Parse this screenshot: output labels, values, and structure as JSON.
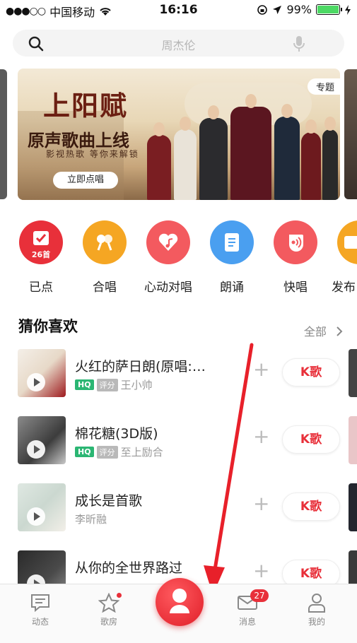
{
  "status_bar": {
    "carrier": "中国移动",
    "time": "16:16",
    "battery": "99%"
  },
  "search": {
    "placeholder": "周杰伦"
  },
  "banner": {
    "title": "上阳赋",
    "subtitle": "原声歌曲上线",
    "tagline": "影视热歌 等你来解锁",
    "button": "立即点唱",
    "tag": "专题"
  },
  "quick_actions": [
    {
      "label": "已点",
      "badge": "26首",
      "color": "#e8303a"
    },
    {
      "label": "合唱",
      "color": "#f5a623"
    },
    {
      "label": "心动对唱",
      "color": "#f35a5f"
    },
    {
      "label": "朗诵",
      "color": "#4a9ff0"
    },
    {
      "label": "快唱",
      "color": "#f35a5f"
    },
    {
      "label": "发布",
      "color": "#f5a623"
    }
  ],
  "section": {
    "title": "猜你喜欢",
    "all_label": "全部"
  },
  "songs": [
    {
      "title": "火红的萨日朗(原唱:…",
      "hq": "HQ",
      "score": "评分",
      "artist": "王小帅",
      "k_label": "K歌"
    },
    {
      "title": "棉花糖(3D版)",
      "hq": "HQ",
      "score": "评分",
      "artist": "至上励合",
      "k_label": "K歌"
    },
    {
      "title": "成长是首歌",
      "artist": "李昕融",
      "k_label": "K歌"
    },
    {
      "title": "从你的全世界路过",
      "k_label": "K歌"
    }
  ],
  "tab_bar": {
    "tabs": [
      {
        "label": "动态"
      },
      {
        "label": "歌房"
      },
      {
        "label": "消息",
        "badge": "27"
      },
      {
        "label": "我的"
      }
    ]
  },
  "colors": {
    "accent": "#e8303a",
    "hq_green": "#2bb673"
  }
}
